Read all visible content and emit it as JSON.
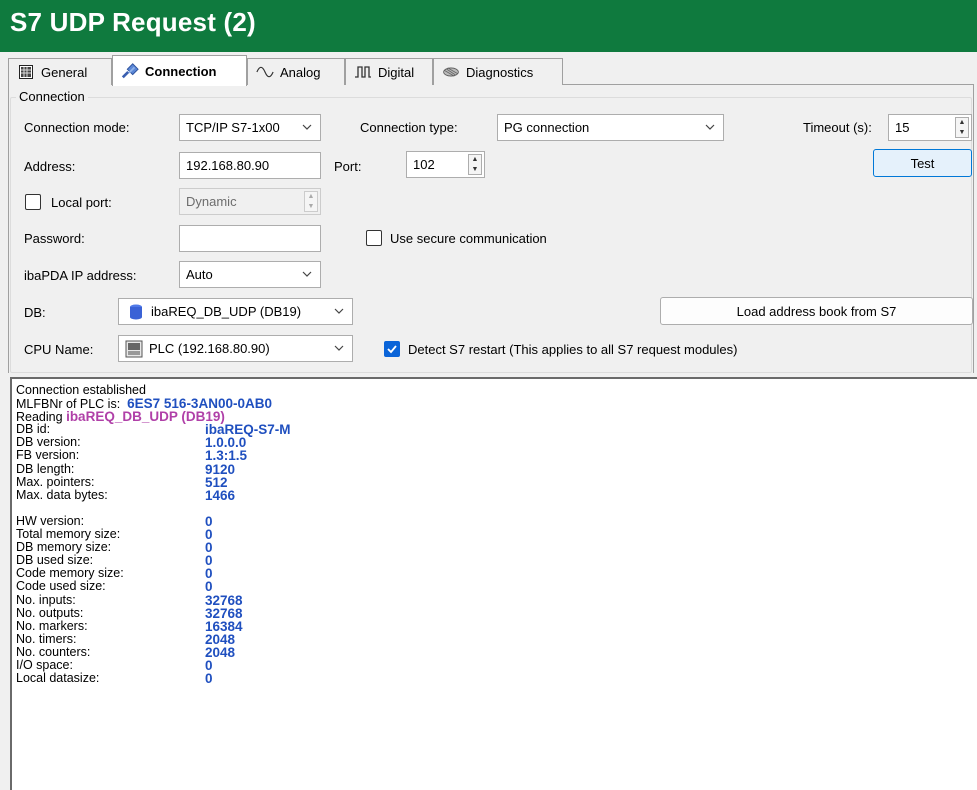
{
  "window": {
    "title": "S7 UDP Request (2)"
  },
  "tabs": [
    {
      "label": "General",
      "icon": "grid-icon"
    },
    {
      "label": "Connection",
      "icon": "plug-icon",
      "active": true
    },
    {
      "label": "Analog",
      "icon": "sine-wave-icon"
    },
    {
      "label": "Digital",
      "icon": "square-wave-icon"
    },
    {
      "label": "Diagnostics",
      "icon": "chip-icon"
    }
  ],
  "connection": {
    "group_label": "Connection",
    "mode_label": "Connection mode:",
    "mode_value": "TCP/IP S7-1x00",
    "type_label": "Connection type:",
    "type_value": "PG connection",
    "timeout_label": "Timeout (s):",
    "timeout_value": "15",
    "address_label": "Address:",
    "address_value": "192.168.80.90",
    "port_label": "Port:",
    "port_value": "102",
    "test_label": "Test",
    "local_port_label": "Local port:",
    "local_port_value": "Dynamic",
    "password_label": "Password:",
    "password_value": "",
    "secure_label": "Use secure communication",
    "ibapda_ip_label": "ibaPDA IP address:",
    "ibapda_ip_value": "Auto",
    "db_label": "DB:",
    "db_value": "ibaREQ_DB_UDP (DB19)",
    "load_addrbook_label": "Load address book from S7",
    "cpu_label": "CPU Name:",
    "cpu_value": "PLC (192.168.80.90)",
    "detect_restart_label": "Detect S7 restart (This applies to all S7 request modules)",
    "detect_restart_checked": true,
    "local_port_checked": false,
    "secure_checked": false
  },
  "log": {
    "line1": "Connection established",
    "mlfb_prefix": "MLFBNr of PLC is:",
    "mlfb_value": "6ES7 516-3AN00-0AB0",
    "reading_prefix": "Reading",
    "reading_value": "ibaREQ_DB_UDP (DB19)",
    "rows_a": [
      {
        "k": "DB id:",
        "v": "ibaREQ-S7-M"
      },
      {
        "k": "DB version:",
        "v": "1.0.0.0"
      },
      {
        "k": "FB version:",
        "v": "1.3:1.5"
      },
      {
        "k": "DB length:",
        "v": "9120"
      },
      {
        "k": "Max. pointers:",
        "v": "512"
      },
      {
        "k": "Max. data bytes:",
        "v": "1466"
      }
    ],
    "rows_b": [
      {
        "k": "HW version:",
        "v": "0"
      },
      {
        "k": "Total memory size:",
        "v": "0"
      },
      {
        "k": "DB memory size:",
        "v": "0"
      },
      {
        "k": "DB used size:",
        "v": "0"
      },
      {
        "k": "Code memory size:",
        "v": "0"
      },
      {
        "k": "Code used size:",
        "v": "0"
      },
      {
        "k": "No. inputs:",
        "v": "32768"
      },
      {
        "k": "No. outputs:",
        "v": "32768"
      },
      {
        "k": "No. markers:",
        "v": "16384"
      },
      {
        "k": "No. timers:",
        "v": "2048"
      },
      {
        "k": "No. counters:",
        "v": "2048"
      },
      {
        "k": "I/O space:",
        "v": "0"
      },
      {
        "k": "Local datasize:",
        "v": "0"
      }
    ]
  }
}
